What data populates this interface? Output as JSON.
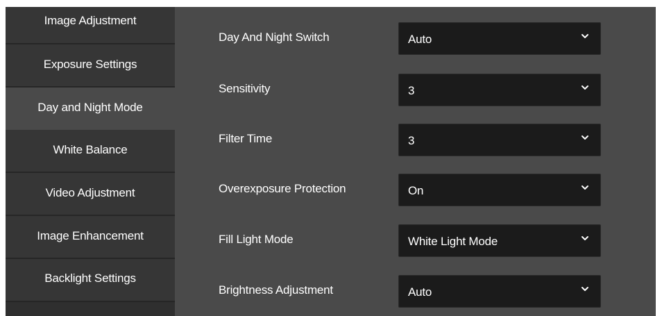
{
  "sidebar": {
    "items": [
      {
        "label": "Image Adjustment",
        "active": false
      },
      {
        "label": "Exposure Settings",
        "active": false
      },
      {
        "label": "Day and Night Mode",
        "active": true
      },
      {
        "label": "White Balance",
        "active": false
      },
      {
        "label": "Video Adjustment",
        "active": false
      },
      {
        "label": "Image Enhancement",
        "active": false
      },
      {
        "label": "Backlight Settings",
        "active": false
      }
    ]
  },
  "form": {
    "fields": [
      {
        "label": "Day And Night Switch",
        "value": "Auto",
        "icon": "chevron-down-icon"
      },
      {
        "label": "Sensitivity",
        "value": "3",
        "icon": "chevron-down-icon"
      },
      {
        "label": "Filter Time",
        "value": "3",
        "icon": "chevron-down-icon"
      },
      {
        "label": "Overexposure Protection",
        "value": "On",
        "icon": "chevron-down-icon"
      },
      {
        "label": "Fill Light Mode",
        "value": "White Light Mode",
        "icon": "chevron-down-icon"
      },
      {
        "label": "Brightness Adjustment",
        "value": "Auto",
        "icon": "chevron-down-icon"
      }
    ]
  },
  "colors": {
    "sidebar_background": "#2f2f2f",
    "sidebar_item": "#363636",
    "active_item": "#4a4a4a",
    "panel_background": "#4a4a4a",
    "select_background": "#1b1b1b",
    "text": "#ffffff"
  }
}
